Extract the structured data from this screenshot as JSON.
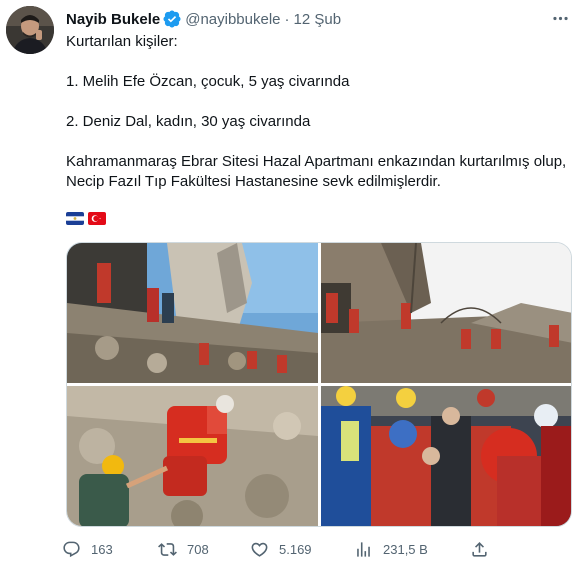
{
  "tweet": {
    "author_name": "Nayib Bukele",
    "handle": "@nayibbukele",
    "separator": "·",
    "time": "12 Şub",
    "lines": [
      "Kurtarılan kişiler:",
      "1. Melih Efe Özcan, çocuk, 5 yaş civarında",
      "2. Deniz Dal, kadın, 30 yaş civarında",
      "Kahramanmaraş Ebrar Sitesi Hazal Apartmanı enkazından kurtarılmış olup, Necip Fazıl Tıp Fakültesi Hastanesine sevk edilmişlerdir."
    ],
    "flags": [
      "el-salvador-flag",
      "turkey-flag"
    ]
  },
  "actions": {
    "replies": "163",
    "retweets": "708",
    "likes": "5.169",
    "views": "231,5 B"
  },
  "colors": {
    "text": "#0f1419",
    "secondary": "#536471",
    "verified": "#1d9bf0",
    "border": "#cfd9de"
  }
}
